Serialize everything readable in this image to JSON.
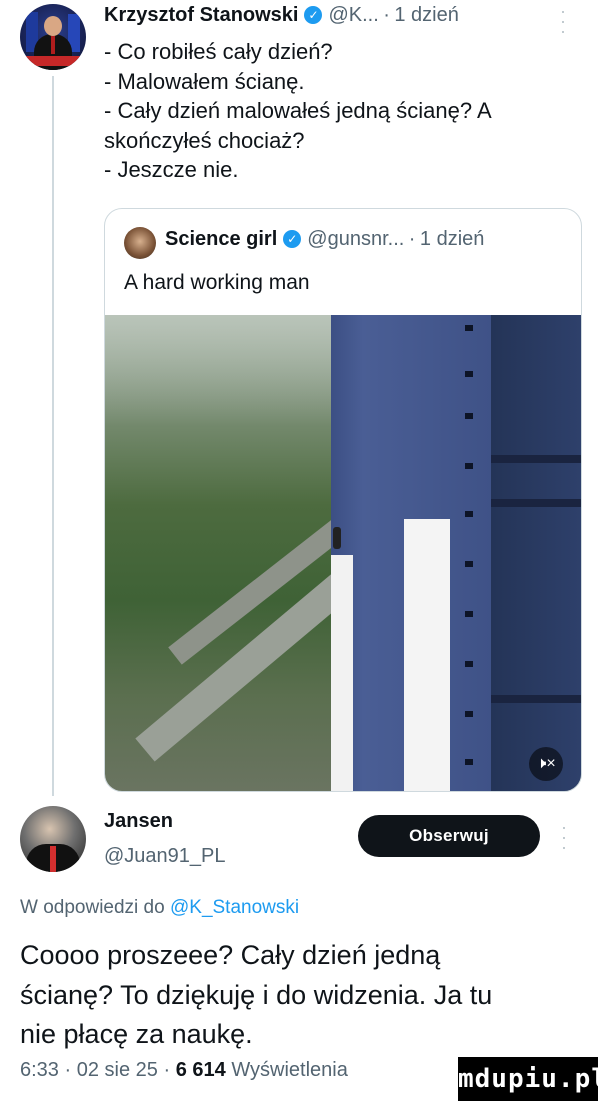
{
  "tweet": {
    "author_name": "Krzysztof Stanowski",
    "author_handle": "@K...",
    "separator": "·",
    "time": "1 dzień",
    "more_icon": "more-vertical-icon",
    "lines": [
      "- Co robiłeś cały dzień?",
      "- Malowałem ścianę.",
      "- Cały dzień malowałeś jedną ścianę? A",
      "skończyłeś chociaż?",
      "- Jeszcze nie."
    ]
  },
  "quote": {
    "author_name": "Science girl",
    "author_handle": "@gunsnr...",
    "separator": "·",
    "time": "1 dzień",
    "text": "A hard working man",
    "volume_icon": "volume-muted-icon",
    "volume_glyph": "🕨×"
  },
  "reply": {
    "author_name": "Jansen",
    "author_handle": "@Juan91_PL",
    "follow_label": "Obserwuj",
    "replying_prefix": "W odpowiedzi do",
    "replying_to": "@K_Stanowski",
    "lines": [
      "Coooo proszeee? Cały dzień jedną",
      "ścianę? To dziękuję i do widzenia. Ja tu",
      "nie płacę za naukę."
    ],
    "footer_time": "6:33",
    "footer_date": "02 sie 25",
    "footer_views_count": "6 614",
    "footer_views_label": "Wyświetlenia",
    "footer_sep": "·"
  },
  "watermark": "mdupiu.pl",
  "colors": {
    "verified_blue": "#1d9bf0",
    "secondary_text": "#536471",
    "primary_text": "#0f1419",
    "follow_button_bg": "#0f1419"
  }
}
